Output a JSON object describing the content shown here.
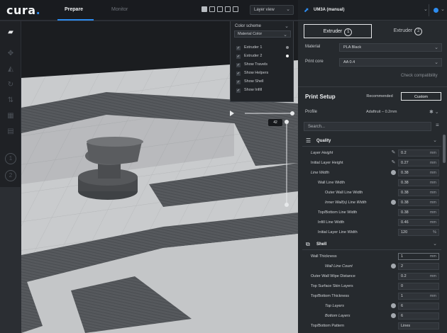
{
  "app": {
    "logo": "cura",
    "logo_dot": "."
  },
  "tabs": [
    {
      "label": "Prepare"
    },
    {
      "label": "Monitor"
    }
  ],
  "view_select": {
    "value": "Layer view"
  },
  "color_scheme": {
    "title": "Color scheme",
    "selected": "Material Color",
    "items": [
      {
        "label": "Extruder 1",
        "checked": true,
        "color": "#8c8f93"
      },
      {
        "label": "Extruder 2",
        "checked": true,
        "color": "#f2f2f2"
      },
      {
        "label": "Show Travels",
        "checked": true
      },
      {
        "label": "Show Helpers",
        "checked": true
      },
      {
        "label": "Show Shell",
        "checked": true
      },
      {
        "label": "Show Infill",
        "checked": true
      }
    ]
  },
  "layer_badge": "42",
  "printer": {
    "name": "UM3A (manual)",
    "status_color": "#2d8cf0"
  },
  "extruders": [
    {
      "label": "Extruder",
      "number": "1"
    },
    {
      "label": "Extruder",
      "number": "2"
    }
  ],
  "material": {
    "label": "Material",
    "value": "PLA Black"
  },
  "print_core": {
    "label": "Print core",
    "value": "AA 0.4"
  },
  "check_compat": "Check compatibility",
  "print_setup": {
    "title": "Print Setup",
    "recommended": "Recommended",
    "custom": "Custom"
  },
  "profile": {
    "label": "Profile",
    "value": "Adaftruit – 0.2mm"
  },
  "search": {
    "placeholder": "Search..."
  },
  "categories": [
    {
      "label": "Quality"
    },
    {
      "label": "Shell"
    }
  ],
  "quality_settings": [
    {
      "label": "Layer Height",
      "value": "0.2",
      "unit": "mm",
      "icon": "edit",
      "indent": 0,
      "italic": true
    },
    {
      "label": "Initial Layer Height",
      "value": "0.27",
      "unit": "mm",
      "icon": "edit",
      "indent": 0
    },
    {
      "label": "Line Width",
      "value": "0.38",
      "unit": "mm",
      "icon": "reset",
      "indent": 0,
      "italic": true
    },
    {
      "label": "Wall Line Width",
      "value": "0.38",
      "unit": "mm",
      "indent": 1
    },
    {
      "label": "Outer Wall Line Width",
      "value": "0.38",
      "unit": "mm",
      "indent": 2
    },
    {
      "label": "Inner Wall(s) Line Width",
      "value": "0.38",
      "unit": "mm",
      "icon": "reset",
      "indent": 2,
      "italic": true
    },
    {
      "label": "Top/Bottom Line Width",
      "value": "0.38",
      "unit": "mm",
      "indent": 1
    },
    {
      "label": "Infill Line Width",
      "value": "0.46",
      "unit": "mm",
      "indent": 1
    },
    {
      "label": "Initial Layer Line Width",
      "value": "120",
      "unit": "%",
      "indent": 1
    }
  ],
  "shell_settings": [
    {
      "label": "Wall Thickness",
      "value": "1",
      "unit": "mm",
      "indent": 0,
      "boxed": true
    },
    {
      "label": "Wall Line Count",
      "value": "2",
      "unit": "",
      "icon": "reset",
      "indent": 2,
      "italic": true
    },
    {
      "label": "Outer Wall Wipe Distance",
      "value": "0.2",
      "unit": "mm",
      "indent": 0
    },
    {
      "label": "Top Surface Skin Layers",
      "value": "0",
      "unit": "",
      "indent": 0
    },
    {
      "label": "Top/Bottom Thickness",
      "value": "1",
      "unit": "mm",
      "indent": 0
    },
    {
      "label": "Top Layers",
      "value": "6",
      "unit": "",
      "icon": "reset",
      "indent": 2,
      "italic": true
    },
    {
      "label": "Bottom Layers",
      "value": "6",
      "unit": "",
      "icon": "reset",
      "indent": 2,
      "italic": true
    },
    {
      "label": "Top/Bottom Pattern",
      "value": "Lines",
      "unit": "",
      "indent": 0
    }
  ]
}
